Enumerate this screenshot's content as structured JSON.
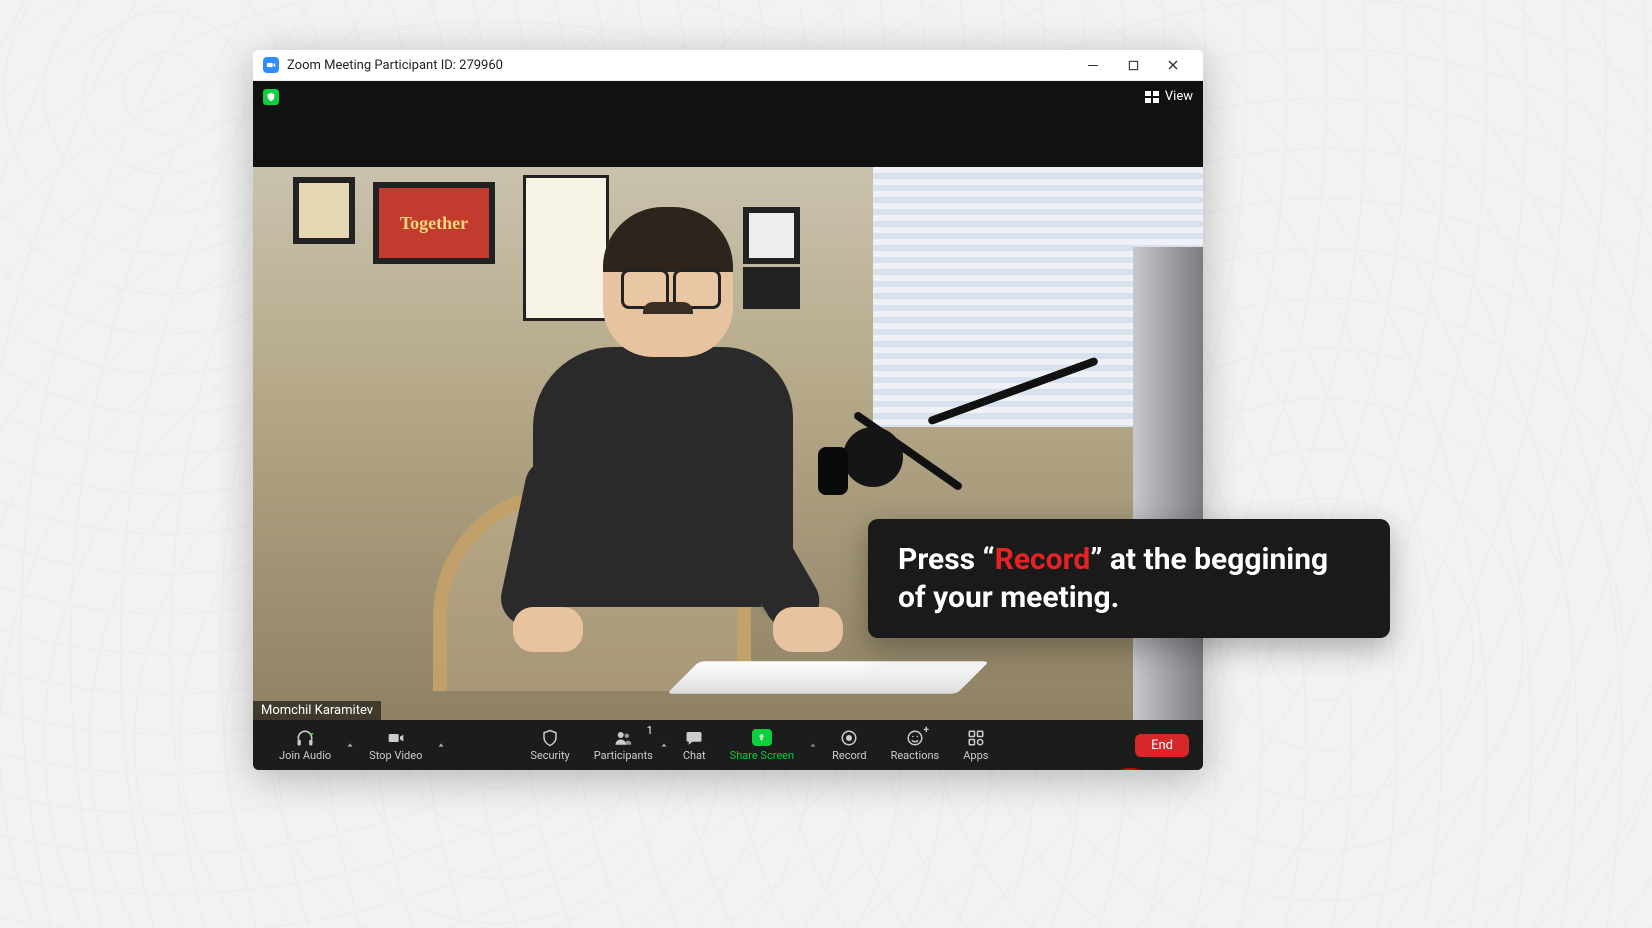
{
  "window_title": "Zoom Meeting Participant ID: 279960",
  "topbar": {
    "view_label": "View"
  },
  "participant_name": "Momchil Karamitev",
  "controls": {
    "join_audio": "Join Audio",
    "stop_video": "Stop Video",
    "security": "Security",
    "participants": "Participants",
    "participants_count": "1",
    "chat": "Chat",
    "share_screen": "Share Screen",
    "record": "Record",
    "reactions": "Reactions",
    "apps": "Apps",
    "end": "End"
  },
  "annotation": {
    "prefix": "Press “",
    "highlight": "Record",
    "suffix": "” at the beggining of your meeting."
  }
}
